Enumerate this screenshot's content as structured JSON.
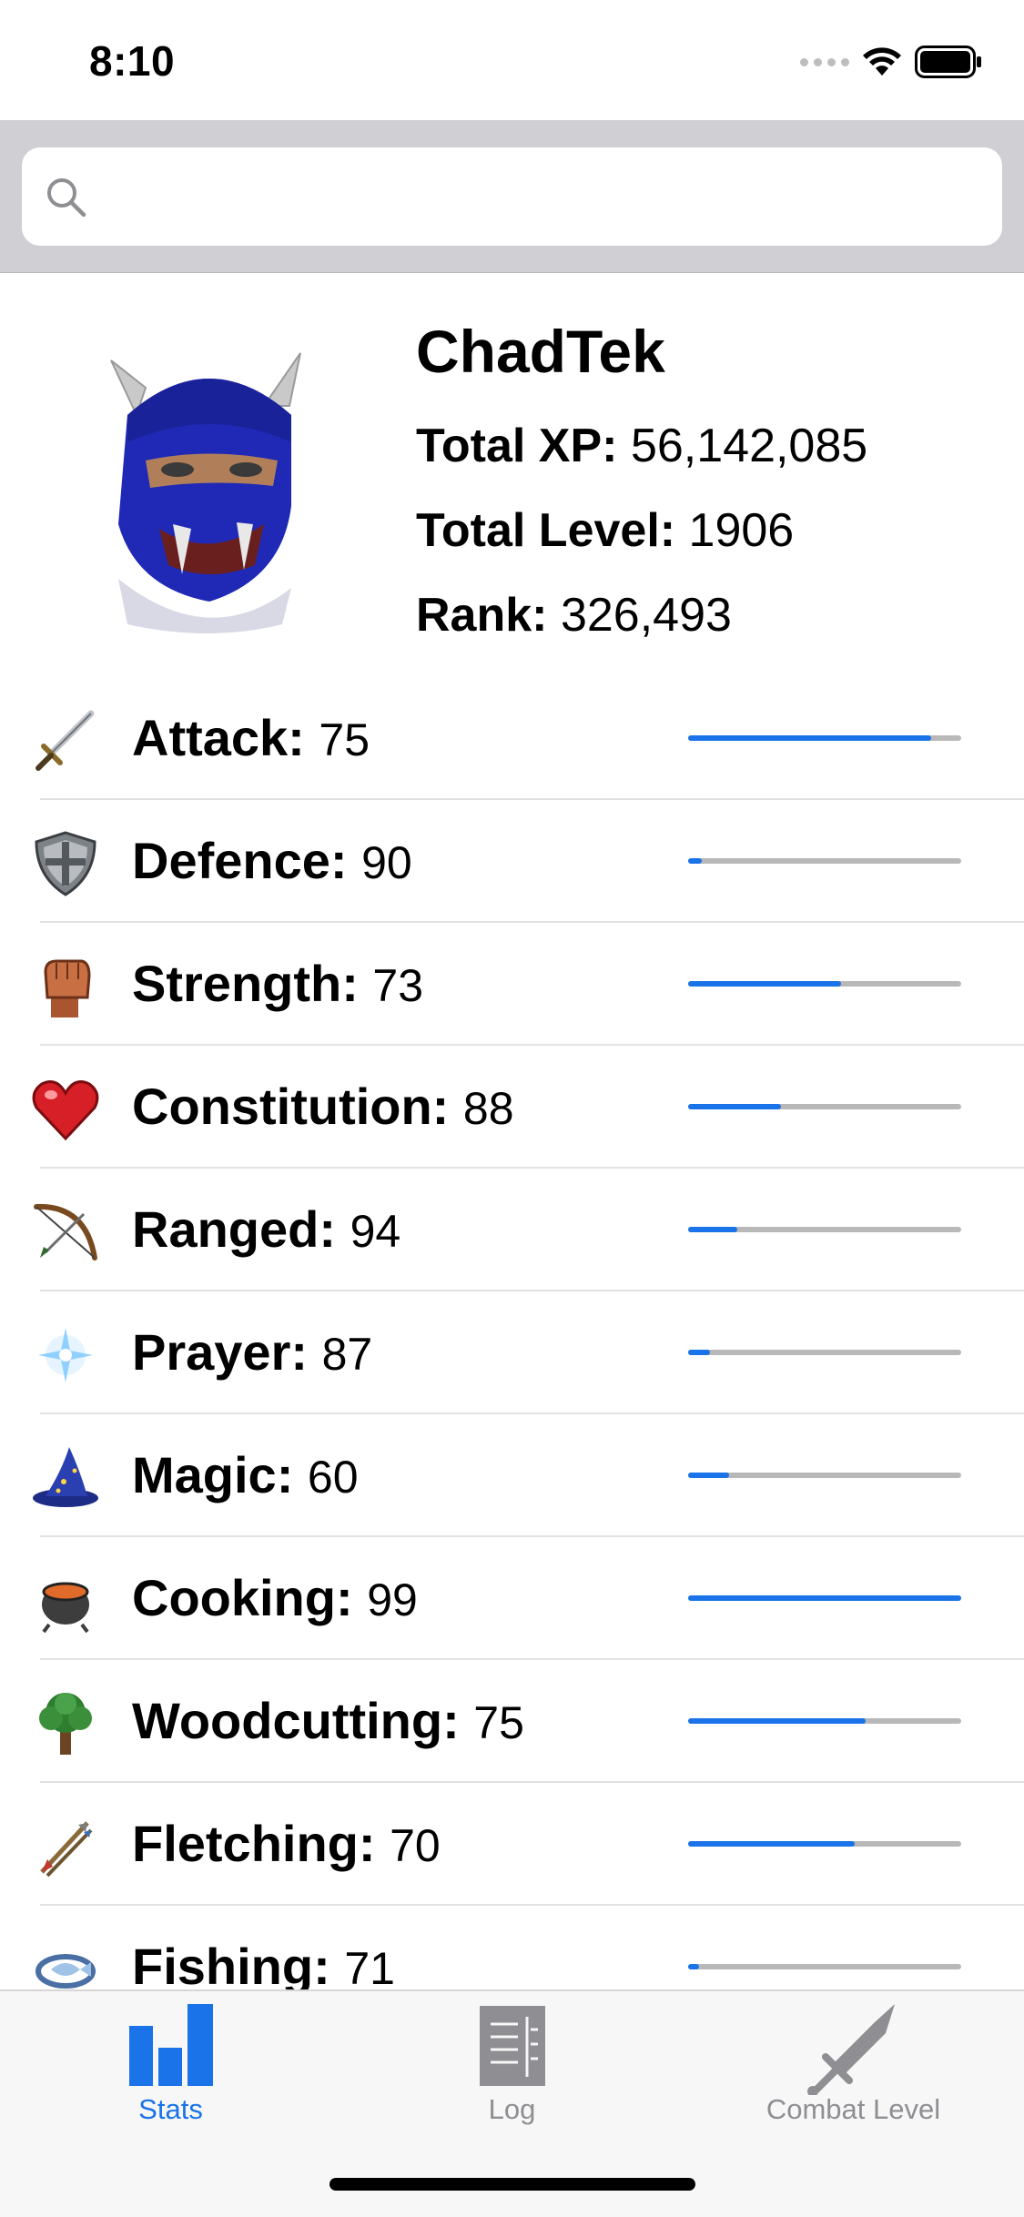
{
  "status_bar": {
    "time": "8:10"
  },
  "search": {
    "placeholder": "",
    "value": ""
  },
  "profile": {
    "name": "ChadTek",
    "total_xp_label": "Total XP:",
    "total_xp": "56,142,085",
    "total_level_label": "Total Level:",
    "total_level": "1906",
    "rank_label": "Rank:",
    "rank": "326,493"
  },
  "skills": [
    {
      "name": "Attack:",
      "level": "75",
      "icon": "sword-icon",
      "progress": 0.89
    },
    {
      "name": "Defence:",
      "level": "90",
      "icon": "shield-icon",
      "progress": 0.05
    },
    {
      "name": "Strength:",
      "level": "73",
      "icon": "fist-icon",
      "progress": 0.56
    },
    {
      "name": "Constitution:",
      "level": "88",
      "icon": "heart-icon",
      "progress": 0.34
    },
    {
      "name": "Ranged:",
      "level": "94",
      "icon": "bow-icon",
      "progress": 0.18
    },
    {
      "name": "Prayer:",
      "level": "87",
      "icon": "star-glow-icon",
      "progress": 0.08
    },
    {
      "name": "Magic:",
      "level": "60",
      "icon": "wizard-hat-icon",
      "progress": 0.15
    },
    {
      "name": "Cooking:",
      "level": "99",
      "icon": "cooking-pot-icon",
      "progress": 1.0
    },
    {
      "name": "Woodcutting:",
      "level": "75",
      "icon": "tree-icon",
      "progress": 0.65
    },
    {
      "name": "Fletching:",
      "level": "70",
      "icon": "arrows-icon",
      "progress": 0.61
    },
    {
      "name": "Fishing:",
      "level": "71",
      "icon": "fishing-icon",
      "progress": 0.04
    }
  ],
  "tabs": [
    {
      "label": "Stats",
      "icon": "bar-chart-icon",
      "active": true
    },
    {
      "label": "Log",
      "icon": "log-document-icon",
      "active": false
    },
    {
      "label": "Combat Level",
      "icon": "sword-icon",
      "active": false
    }
  ],
  "colors": {
    "accent": "#1a73e8",
    "inactive": "#8e8e93",
    "track": "#b8b8b8"
  }
}
